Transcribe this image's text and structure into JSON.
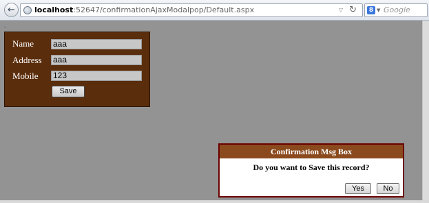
{
  "browser": {
    "url_host": "localhost",
    "url_rest": ":52647/confirmationAjaxModalpop/Default.aspx",
    "search_placeholder": "Google",
    "back_icon": "back-arrow-icon",
    "reload_icon": "reload-icon"
  },
  "page": {
    "dot": "."
  },
  "form": {
    "name_label": "Name",
    "name_value": "aaa",
    "address_label": "Address",
    "address_value": "aaa",
    "mobile_label": "Mobile",
    "mobile_value": "123",
    "save_label": "Save"
  },
  "modal": {
    "title": "Confirmation Msg Box",
    "message": "Do you want to Save this record?",
    "yes_label": "Yes",
    "no_label": "No"
  },
  "colors": {
    "panel_bg": "#5a2d0c",
    "modal_header_bg": "#8b4a1d",
    "modal_border": "#6b0000",
    "overlay": "#939393"
  }
}
